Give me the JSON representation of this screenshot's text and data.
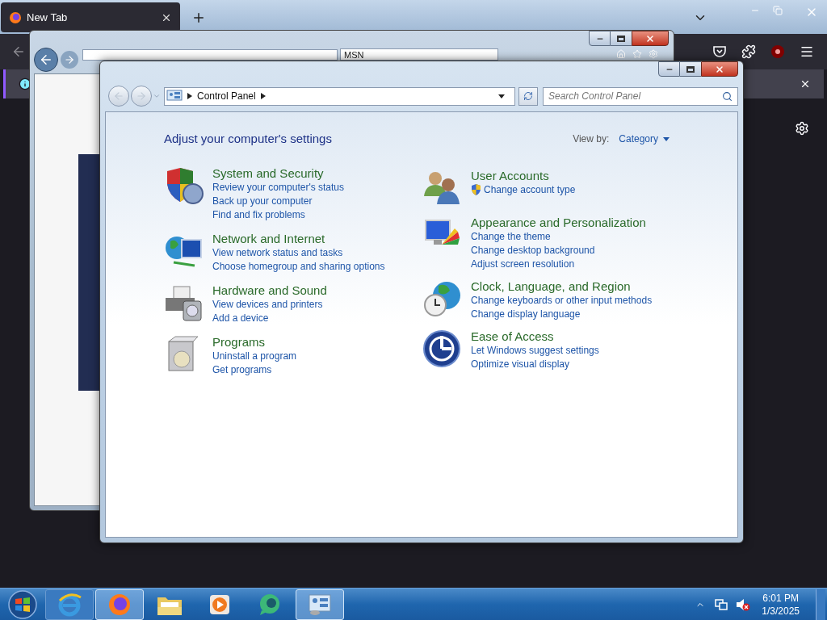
{
  "browser": {
    "tabs": [
      {
        "label": "New Tab",
        "selected": true
      }
    ]
  },
  "ie_window": {
    "tabs": [
      {
        "label": "MSN",
        "selected": true
      }
    ]
  },
  "control_panel": {
    "address": {
      "crumbs": [
        "Control Panel"
      ]
    },
    "search": {
      "placeholder": "Search Control Panel"
    },
    "heading": "Adjust your computer's settings",
    "view_by": {
      "label": "View by:",
      "value": "Category"
    },
    "columns": [
      [
        {
          "kind": "security",
          "title": "System and Security",
          "links": [
            {
              "text": "Review your computer's status",
              "shield": false
            },
            {
              "text": "Back up your computer",
              "shield": false
            },
            {
              "text": "Find and fix problems",
              "shield": false
            }
          ]
        },
        {
          "kind": "network",
          "title": "Network and Internet",
          "links": [
            {
              "text": "View network status and tasks",
              "shield": false
            },
            {
              "text": "Choose homegroup and sharing options",
              "shield": false
            }
          ]
        },
        {
          "kind": "hardware",
          "title": "Hardware and Sound",
          "links": [
            {
              "text": "View devices and printers",
              "shield": false
            },
            {
              "text": "Add a device",
              "shield": false
            }
          ]
        },
        {
          "kind": "programs",
          "title": "Programs",
          "links": [
            {
              "text": "Uninstall a program",
              "shield": false
            },
            {
              "text": "Get programs",
              "shield": false
            }
          ]
        }
      ],
      [
        {
          "kind": "users",
          "title": "User Accounts",
          "links": [
            {
              "text": "Change account type",
              "shield": true
            }
          ]
        },
        {
          "kind": "appearance",
          "title": "Appearance and Personalization",
          "links": [
            {
              "text": "Change the theme",
              "shield": false
            },
            {
              "text": "Change desktop background",
              "shield": false
            },
            {
              "text": "Adjust screen resolution",
              "shield": false
            }
          ]
        },
        {
          "kind": "clock",
          "title": "Clock, Language, and Region",
          "links": [
            {
              "text": "Change keyboards or other input methods",
              "shield": false
            },
            {
              "text": "Change display language",
              "shield": false
            }
          ]
        },
        {
          "kind": "access",
          "title": "Ease of Access",
          "links": [
            {
              "text": "Let Windows suggest settings",
              "shield": false
            },
            {
              "text": "Optimize visual display",
              "shield": false
            }
          ]
        }
      ]
    ]
  },
  "taskbar": {
    "items": [
      {
        "kind": "ie",
        "selected": false
      },
      {
        "kind": "firefox",
        "selected": true
      },
      {
        "kind": "folder",
        "selected": false
      },
      {
        "kind": "media",
        "selected": false
      },
      {
        "kind": "chat",
        "selected": false
      },
      {
        "kind": "control",
        "selected": true
      }
    ],
    "clock": {
      "time": "6:01 PM",
      "date": "1/3/2025"
    }
  }
}
